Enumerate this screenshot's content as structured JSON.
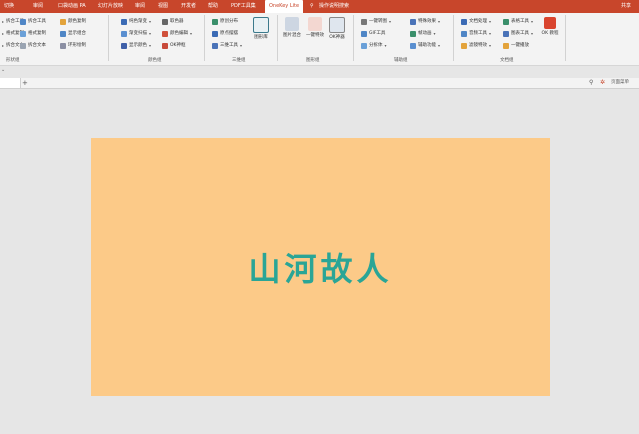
{
  "menu": {
    "tabs": [
      "切换",
      "审阅",
      "口袋动画 PA",
      "幻灯片放映",
      "审阅",
      "视图",
      "开发者",
      "帮助",
      "PDF工具集",
      "OneKey Lite",
      "操作说明搜索"
    ],
    "active": "OneKey Lite",
    "user": "共享"
  },
  "ribbon": {
    "groups": [
      {
        "name": "形状组",
        "items": [
          "拆合工具",
          "格式复制",
          "拆合文本",
          "颜色复制",
          "显示组合",
          "环形绘制"
        ]
      },
      {
        "name": "颜色组",
        "items": [
          "纯色渐变",
          "渐变扫描",
          "显示颜色",
          "取色器",
          "颜色编辑",
          "OK神框"
        ]
      },
      {
        "name": "三维组",
        "items": [
          "原创分布",
          "原点摆摆",
          "三维工具",
          "图形库"
        ]
      },
      {
        "name": "图形组",
        "items": [
          "图片混合",
          "一键特效",
          "OK神器"
        ]
      },
      {
        "name": "辅助组",
        "items": [
          "一键转图",
          "GIF工具",
          "分拆体",
          "特殊效果",
          "帧动画",
          "辅助功能"
        ]
      },
      {
        "name": "文档组",
        "items": [
          "文档处理",
          "音频工具",
          "滤镜特效",
          "表格工具",
          "图表工具",
          "一键播放",
          "OK 教程"
        ]
      }
    ]
  },
  "tabsbar": {
    "add": "+",
    "right_label": "页面菜单"
  },
  "slide": {
    "title": "山河故人"
  },
  "colors": {
    "accent": "#c8462b",
    "slide_bg": "#fcca88",
    "title": "#2aa596"
  }
}
